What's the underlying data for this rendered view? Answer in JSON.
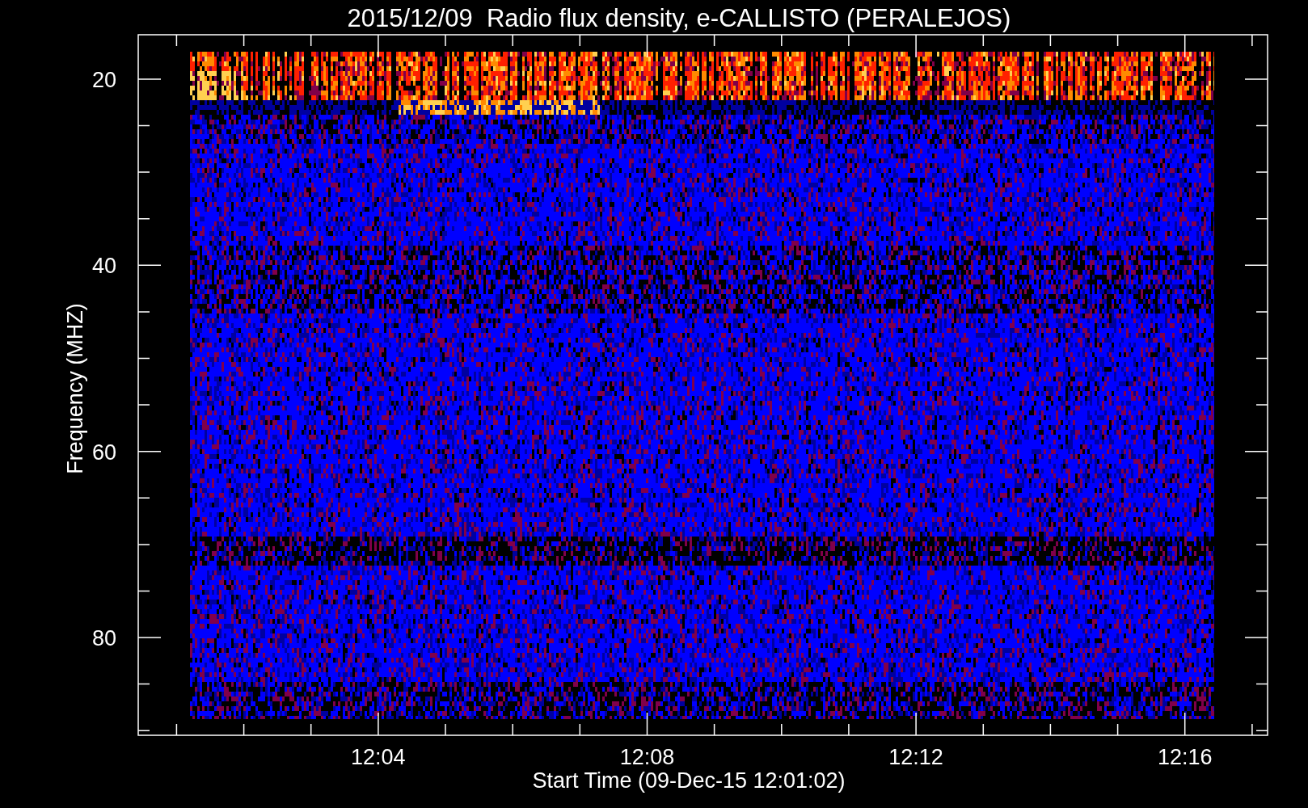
{
  "title": "2015/12/09  Radio flux density, e-CALLISTO (PERALEJOS)",
  "y_axis": {
    "label": "Frequency (MHZ)",
    "ticks": [
      "20",
      "40",
      "60",
      "80"
    ]
  },
  "x_axis": {
    "label": "Start Time (09-Dec-15 12:01:02)",
    "ticks": [
      "12:04",
      "12:08",
      "12:12",
      "12:16"
    ]
  }
}
